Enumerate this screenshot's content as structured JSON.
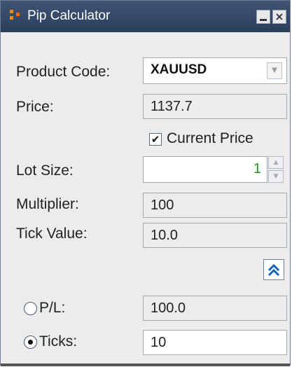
{
  "window": {
    "title": "Pip Calculator"
  },
  "fields": {
    "product_code": {
      "label": "Product Code:",
      "value": "XAUUSD"
    },
    "price": {
      "label": "Price:",
      "value": "1137.7"
    },
    "current_price": {
      "label": "Current Price",
      "checked": true
    },
    "lot_size": {
      "label": "Lot Size:",
      "value": "1"
    },
    "multiplier": {
      "label": "Multiplier:",
      "value": "100"
    },
    "tick_value": {
      "label": "Tick Value:",
      "value": "10.0"
    },
    "pl": {
      "label": "P/L:",
      "value": "100.0",
      "selected": false
    },
    "ticks": {
      "label": "Ticks:",
      "value": "10",
      "selected": true
    }
  },
  "colors": {
    "titlebar": "#2f4563",
    "lot_value": "#16a01a"
  }
}
